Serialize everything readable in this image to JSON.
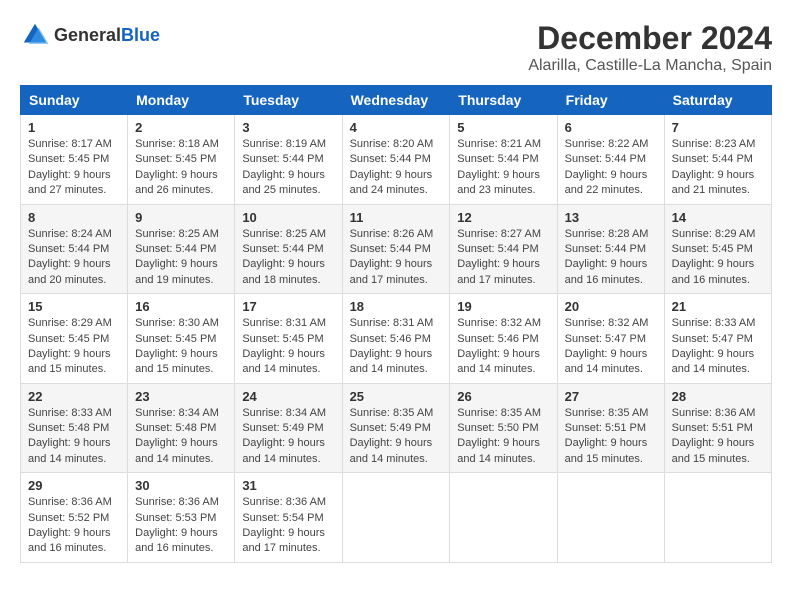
{
  "logo": {
    "text_general": "General",
    "text_blue": "Blue"
  },
  "header": {
    "month_year": "December 2024",
    "location": "Alarilla, Castille-La Mancha, Spain"
  },
  "weekdays": [
    "Sunday",
    "Monday",
    "Tuesday",
    "Wednesday",
    "Thursday",
    "Friday",
    "Saturday"
  ],
  "weeks": [
    [
      {
        "day": "1",
        "sunrise": "Sunrise: 8:17 AM",
        "sunset": "Sunset: 5:45 PM",
        "daylight": "Daylight: 9 hours and 27 minutes."
      },
      {
        "day": "2",
        "sunrise": "Sunrise: 8:18 AM",
        "sunset": "Sunset: 5:45 PM",
        "daylight": "Daylight: 9 hours and 26 minutes."
      },
      {
        "day": "3",
        "sunrise": "Sunrise: 8:19 AM",
        "sunset": "Sunset: 5:44 PM",
        "daylight": "Daylight: 9 hours and 25 minutes."
      },
      {
        "day": "4",
        "sunrise": "Sunrise: 8:20 AM",
        "sunset": "Sunset: 5:44 PM",
        "daylight": "Daylight: 9 hours and 24 minutes."
      },
      {
        "day": "5",
        "sunrise": "Sunrise: 8:21 AM",
        "sunset": "Sunset: 5:44 PM",
        "daylight": "Daylight: 9 hours and 23 minutes."
      },
      {
        "day": "6",
        "sunrise": "Sunrise: 8:22 AM",
        "sunset": "Sunset: 5:44 PM",
        "daylight": "Daylight: 9 hours and 22 minutes."
      },
      {
        "day": "7",
        "sunrise": "Sunrise: 8:23 AM",
        "sunset": "Sunset: 5:44 PM",
        "daylight": "Daylight: 9 hours and 21 minutes."
      }
    ],
    [
      {
        "day": "8",
        "sunrise": "Sunrise: 8:24 AM",
        "sunset": "Sunset: 5:44 PM",
        "daylight": "Daylight: 9 hours and 20 minutes."
      },
      {
        "day": "9",
        "sunrise": "Sunrise: 8:25 AM",
        "sunset": "Sunset: 5:44 PM",
        "daylight": "Daylight: 9 hours and 19 minutes."
      },
      {
        "day": "10",
        "sunrise": "Sunrise: 8:25 AM",
        "sunset": "Sunset: 5:44 PM",
        "daylight": "Daylight: 9 hours and 18 minutes."
      },
      {
        "day": "11",
        "sunrise": "Sunrise: 8:26 AM",
        "sunset": "Sunset: 5:44 PM",
        "daylight": "Daylight: 9 hours and 17 minutes."
      },
      {
        "day": "12",
        "sunrise": "Sunrise: 8:27 AM",
        "sunset": "Sunset: 5:44 PM",
        "daylight": "Daylight: 9 hours and 17 minutes."
      },
      {
        "day": "13",
        "sunrise": "Sunrise: 8:28 AM",
        "sunset": "Sunset: 5:44 PM",
        "daylight": "Daylight: 9 hours and 16 minutes."
      },
      {
        "day": "14",
        "sunrise": "Sunrise: 8:29 AM",
        "sunset": "Sunset: 5:45 PM",
        "daylight": "Daylight: 9 hours and 16 minutes."
      }
    ],
    [
      {
        "day": "15",
        "sunrise": "Sunrise: 8:29 AM",
        "sunset": "Sunset: 5:45 PM",
        "daylight": "Daylight: 9 hours and 15 minutes."
      },
      {
        "day": "16",
        "sunrise": "Sunrise: 8:30 AM",
        "sunset": "Sunset: 5:45 PM",
        "daylight": "Daylight: 9 hours and 15 minutes."
      },
      {
        "day": "17",
        "sunrise": "Sunrise: 8:31 AM",
        "sunset": "Sunset: 5:45 PM",
        "daylight": "Daylight: 9 hours and 14 minutes."
      },
      {
        "day": "18",
        "sunrise": "Sunrise: 8:31 AM",
        "sunset": "Sunset: 5:46 PM",
        "daylight": "Daylight: 9 hours and 14 minutes."
      },
      {
        "day": "19",
        "sunrise": "Sunrise: 8:32 AM",
        "sunset": "Sunset: 5:46 PM",
        "daylight": "Daylight: 9 hours and 14 minutes."
      },
      {
        "day": "20",
        "sunrise": "Sunrise: 8:32 AM",
        "sunset": "Sunset: 5:47 PM",
        "daylight": "Daylight: 9 hours and 14 minutes."
      },
      {
        "day": "21",
        "sunrise": "Sunrise: 8:33 AM",
        "sunset": "Sunset: 5:47 PM",
        "daylight": "Daylight: 9 hours and 14 minutes."
      }
    ],
    [
      {
        "day": "22",
        "sunrise": "Sunrise: 8:33 AM",
        "sunset": "Sunset: 5:48 PM",
        "daylight": "Daylight: 9 hours and 14 minutes."
      },
      {
        "day": "23",
        "sunrise": "Sunrise: 8:34 AM",
        "sunset": "Sunset: 5:48 PM",
        "daylight": "Daylight: 9 hours and 14 minutes."
      },
      {
        "day": "24",
        "sunrise": "Sunrise: 8:34 AM",
        "sunset": "Sunset: 5:49 PM",
        "daylight": "Daylight: 9 hours and 14 minutes."
      },
      {
        "day": "25",
        "sunrise": "Sunrise: 8:35 AM",
        "sunset": "Sunset: 5:49 PM",
        "daylight": "Daylight: 9 hours and 14 minutes."
      },
      {
        "day": "26",
        "sunrise": "Sunrise: 8:35 AM",
        "sunset": "Sunset: 5:50 PM",
        "daylight": "Daylight: 9 hours and 14 minutes."
      },
      {
        "day": "27",
        "sunrise": "Sunrise: 8:35 AM",
        "sunset": "Sunset: 5:51 PM",
        "daylight": "Daylight: 9 hours and 15 minutes."
      },
      {
        "day": "28",
        "sunrise": "Sunrise: 8:36 AM",
        "sunset": "Sunset: 5:51 PM",
        "daylight": "Daylight: 9 hours and 15 minutes."
      }
    ],
    [
      {
        "day": "29",
        "sunrise": "Sunrise: 8:36 AM",
        "sunset": "Sunset: 5:52 PM",
        "daylight": "Daylight: 9 hours and 16 minutes."
      },
      {
        "day": "30",
        "sunrise": "Sunrise: 8:36 AM",
        "sunset": "Sunset: 5:53 PM",
        "daylight": "Daylight: 9 hours and 16 minutes."
      },
      {
        "day": "31",
        "sunrise": "Sunrise: 8:36 AM",
        "sunset": "Sunset: 5:54 PM",
        "daylight": "Daylight: 9 hours and 17 minutes."
      },
      null,
      null,
      null,
      null
    ]
  ]
}
